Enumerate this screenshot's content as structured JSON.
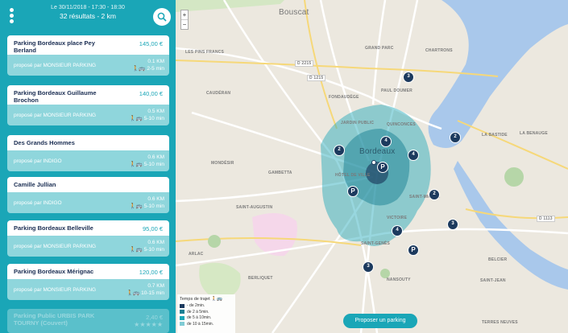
{
  "header": {
    "date_range": "Le 30/11/2018 - 17:30 - 18:30",
    "result_summary": "32 résultats - 2 km"
  },
  "listings": [
    {
      "name": "Parking Bordeaux place Pey Berland",
      "price": "145,00 €",
      "provider": "proposé par MONSIEUR PARKING",
      "distance": "0.1 KM",
      "time": "2-5 min"
    },
    {
      "name": "Parking Bordeaux Guillaume Brochon",
      "price": "140,00 €",
      "provider": "proposé par MONSIEUR PARKING",
      "distance": "0.5 KM",
      "time": "5-10 min"
    },
    {
      "name": "Des Grands Hommes",
      "price": "",
      "provider": "proposé par INDIGO",
      "distance": "0.6 KM",
      "time": "5-10 min"
    },
    {
      "name": "Camille Jullian",
      "price": "",
      "provider": "proposé par INDIGO",
      "distance": "0.6 KM",
      "time": "5-10 min"
    },
    {
      "name": "Parking Bordeaux Belleville",
      "price": "95,00 €",
      "provider": "proposé par MONSIEUR PARKING",
      "distance": "0.6 KM",
      "time": "5-10 min"
    },
    {
      "name": "Parking Bordeaux Mérignac",
      "price": "120,00 €",
      "provider": "proposé par MONSIEUR PARKING",
      "distance": "0.7 KM",
      "time": "10-15 min"
    },
    {
      "name": "Parking Public URBIS PARK TOURNY (Couvert)",
      "price": "2,40 €",
      "provider": "",
      "distance": "",
      "time": "",
      "rating": 5
    }
  ],
  "map": {
    "zoom_in": "+",
    "zoom_out": "−",
    "labels": {
      "bouscat": "Bouscat",
      "les_pins_francs": "LES PINS FRANCS",
      "grand_parc": "GRAND PARC",
      "chartrons": "CHARTRONS",
      "caudéran": "CAUDÉRAN",
      "fondaudege": "FONDAUDÈGE",
      "paul_doumer": "PAUL DOUMER",
      "jardin_public": "JARDIN PUBLIC",
      "quinconces": "QUINCONCES",
      "la_bastide": "LA BASTIDE",
      "la_benauge": "LA BENAUGE",
      "bordeaux": "Bordeaux",
      "monderie": "MONDÉSIR",
      "gambetta": "GAMBETTA",
      "hotel_de_ville": "HÔTEL DE VILLE",
      "saint_augustin": "SAINT-AUGUSTIN",
      "saint_michel": "SAINT-MICHEL",
      "victoire": "VICTOIRE",
      "saint_genes": "SAINT-GENÈS",
      "arlac": "ARLAC",
      "nansouty": "NANSOUTY",
      "belcier": "BELCIER",
      "saint_jean": "SAINT-JEAN",
      "terres_neuves": "TERRES NEUVES",
      "berliquet": "BERLIQUET",
      "d1215": "D 1215",
      "d2215": "D 2215",
      "n113": "D 1113"
    },
    "markers": [
      "3",
      "2",
      "4",
      "4",
      "2",
      "2",
      "3",
      "4",
      "3"
    ],
    "parking_marker": "P",
    "legend": {
      "title": "Temps de trajet",
      "rows": [
        {
          "label": "- de 2min.",
          "color": "#1c3a5e"
        },
        {
          "label": "de 2 à 5min.",
          "color": "#1a7f93"
        },
        {
          "label": "de 5 à 10min.",
          "color": "#1aa6b7"
        },
        {
          "label": "de 10 à 15min.",
          "color": "#7fcbd4"
        }
      ]
    },
    "propose_button": "Proposer un parking"
  },
  "colors": {
    "accent": "#1aa6b7",
    "navy": "#1c3a5e",
    "card_bottom": "#8fd6dc"
  }
}
